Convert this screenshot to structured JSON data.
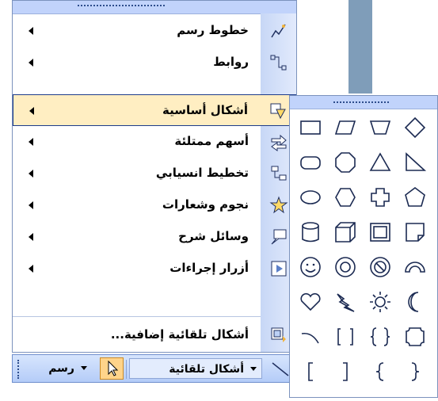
{
  "menu": {
    "items": [
      {
        "label": "خطوط رسم",
        "icon": "lines-icon",
        "highlighted": false
      },
      {
        "label": "روابط",
        "icon": "connectors-icon",
        "highlighted": false
      },
      {
        "label": "أشكال أساسية",
        "icon": "basic-shapes-icon",
        "highlighted": true
      },
      {
        "label": "أسهم ممتلئة",
        "icon": "block-arrows-icon",
        "highlighted": false
      },
      {
        "label": "تخطيط انسيابي",
        "icon": "flowchart-icon",
        "highlighted": false
      },
      {
        "label": "نجوم وشعارات",
        "icon": "stars-banners-icon",
        "highlighted": false
      },
      {
        "label": "وسائل شرح",
        "icon": "callouts-icon",
        "highlighted": false
      },
      {
        "label": "أزرار إجراءات",
        "icon": "action-buttons-icon",
        "highlighted": false
      }
    ],
    "more_label": "أشكال تلقائية إضافية..."
  },
  "toolbar": {
    "autoshapes_label": "أشكال تلقائية",
    "draw_label": "رسم"
  },
  "palette": {
    "shapes": [
      "rectangle",
      "parallelogram",
      "trapezoid",
      "diamond",
      "rounded-rectangle",
      "octagon",
      "triangle",
      "right-triangle",
      "oval",
      "hexagon",
      "cross",
      "pentagon",
      "can",
      "cube",
      "bevel",
      "folded-corner",
      "smiley-face",
      "donut",
      "no-symbol",
      "block-arc",
      "heart",
      "lightning-bolt",
      "sun",
      "moon",
      "arc",
      "double-bracket",
      "double-brace",
      "plaque",
      "left-bracket",
      "right-bracket",
      "left-brace",
      "right-brace"
    ]
  }
}
